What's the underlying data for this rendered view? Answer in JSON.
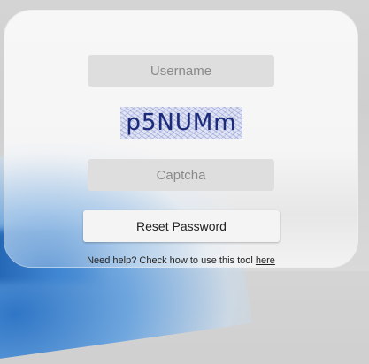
{
  "form": {
    "username_placeholder": "Username",
    "captcha_image_text": "p5NUMm",
    "captcha_placeholder": "Captcha",
    "submit_label": "Reset Password"
  },
  "help": {
    "text": "Need help? Check how to use this tool",
    "link_label": "here"
  },
  "colors": {
    "card_background": "#f7f7f7",
    "input_background": "#dedede",
    "captcha_text": "#1c2a7a",
    "accent_blue": "#2f76c6"
  }
}
